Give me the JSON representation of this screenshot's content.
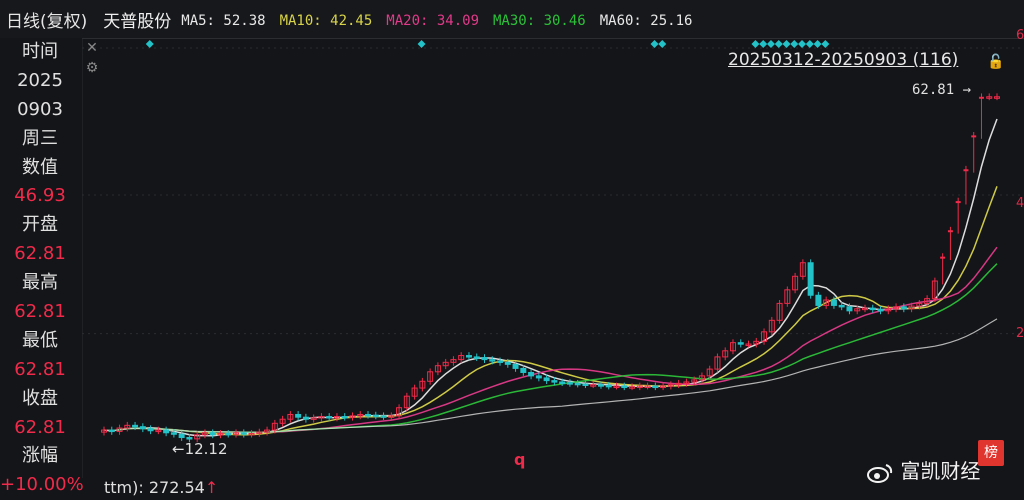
{
  "header": {
    "period": "日线(复权)",
    "stock": "天普股份",
    "ma": [
      {
        "label": "MA5: ",
        "value": "52.38",
        "color": "#e8e8e8"
      },
      {
        "label": "MA10: ",
        "value": "42.45",
        "color": "#d8d44a"
      },
      {
        "label": "MA20: ",
        "value": "34.09",
        "color": "#e03a8a"
      },
      {
        "label": "MA30: ",
        "value": "30.46",
        "color": "#2cc03a"
      },
      {
        "label": "MA60: ",
        "value": "25.16",
        "color": "#e8e8e8"
      }
    ]
  },
  "info_panel": [
    {
      "text": "时间",
      "kind": "lbl"
    },
    {
      "text": "2025",
      "kind": "lbl"
    },
    {
      "text": "0903",
      "kind": "lbl"
    },
    {
      "text": "周三",
      "kind": "lbl"
    },
    {
      "text": "数值",
      "kind": "lbl"
    },
    {
      "text": "46.93",
      "kind": "val"
    },
    {
      "text": "开盘",
      "kind": "lbl"
    },
    {
      "text": "62.81",
      "kind": "val"
    },
    {
      "text": "最高",
      "kind": "lbl"
    },
    {
      "text": "62.81",
      "kind": "val"
    },
    {
      "text": "最低",
      "kind": "lbl"
    },
    {
      "text": "62.81",
      "kind": "val"
    },
    {
      "text": "收盘",
      "kind": "lbl"
    },
    {
      "text": "62.81",
      "kind": "val"
    },
    {
      "text": "涨幅",
      "kind": "lbl"
    },
    {
      "text": "+10.00%",
      "kind": "val"
    }
  ],
  "range_label": "20250312-20250903 (116)",
  "high_marker": "62.81 →",
  "low_marker": "←12.12",
  "bottom_text": {
    "prefix": "ttm):",
    "value": "272.54",
    "arrow": "↑"
  },
  "watermark": "富凯财经",
  "q_mark": "q",
  "badge": "榜",
  "right_ticks": [
    "6",
    "4",
    "2"
  ],
  "colors": {
    "up": "#f02a4a",
    "down": "#22c2c8",
    "bg": "#141518",
    "grid": "#2a2c31"
  },
  "chart_data": {
    "type": "candlestick",
    "title": "天普股份",
    "ylim": [
      8,
      70
    ],
    "date_range": [
      "20250312",
      "20250903"
    ],
    "count": 116,
    "close": [
      13.6,
      13.4,
      13.9,
      14.3,
      14.1,
      13.8,
      13.5,
      13.6,
      13.2,
      13.0,
      12.5,
      12.3,
      12.9,
      13.2,
      12.9,
      13.1,
      13.0,
      13.2,
      13.0,
      13.1,
      13.3,
      13.6,
      14.6,
      15.2,
      15.9,
      15.5,
      15.2,
      15.4,
      15.6,
      15.4,
      15.6,
      15.5,
      15.7,
      15.9,
      15.8,
      15.7,
      15.6,
      15.7,
      16.9,
      18.6,
      19.8,
      20.8,
      22.2,
      23.1,
      23.6,
      24.0,
      24.6,
      24.4,
      24.3,
      24.0,
      23.8,
      23.6,
      23.3,
      22.7,
      22.1,
      21.6,
      21.3,
      20.9,
      20.7,
      20.6,
      20.5,
      20.4,
      20.3,
      20.3,
      20.2,
      20.1,
      20.1,
      20.0,
      20.0,
      20.1,
      20.1,
      20.0,
      20.1,
      20.3,
      20.5,
      20.7,
      21.0,
      21.6,
      22.6,
      24.4,
      25.3,
      26.5,
      26.3,
      26.3,
      26.7,
      28.1,
      29.8,
      32.3,
      34.3,
      36.3,
      38.3,
      33.5,
      32.0,
      32.8,
      32.0,
      31.8,
      31.2,
      31.5,
      31.6,
      31.4,
      31.2,
      31.5,
      31.8,
      31.5,
      31.9,
      32.3,
      33.0,
      35.6,
      39.2,
      43.1,
      47.4,
      52.1,
      57.1,
      62.8,
      62.8,
      62.8
    ],
    "ma_series": [
      {
        "name": "MA5",
        "color": "#e8e8e8"
      },
      {
        "name": "MA10",
        "color": "#d8d44a"
      },
      {
        "name": "MA20",
        "color": "#e03a8a"
      },
      {
        "name": "MA30",
        "color": "#2cc03a"
      },
      {
        "name": "MA60",
        "color": "#e8e8e8"
      }
    ],
    "event_markers_x_index": [
      1,
      36,
      66,
      67,
      79,
      80,
      81,
      82,
      83,
      84,
      85,
      86,
      87,
      88
    ]
  }
}
